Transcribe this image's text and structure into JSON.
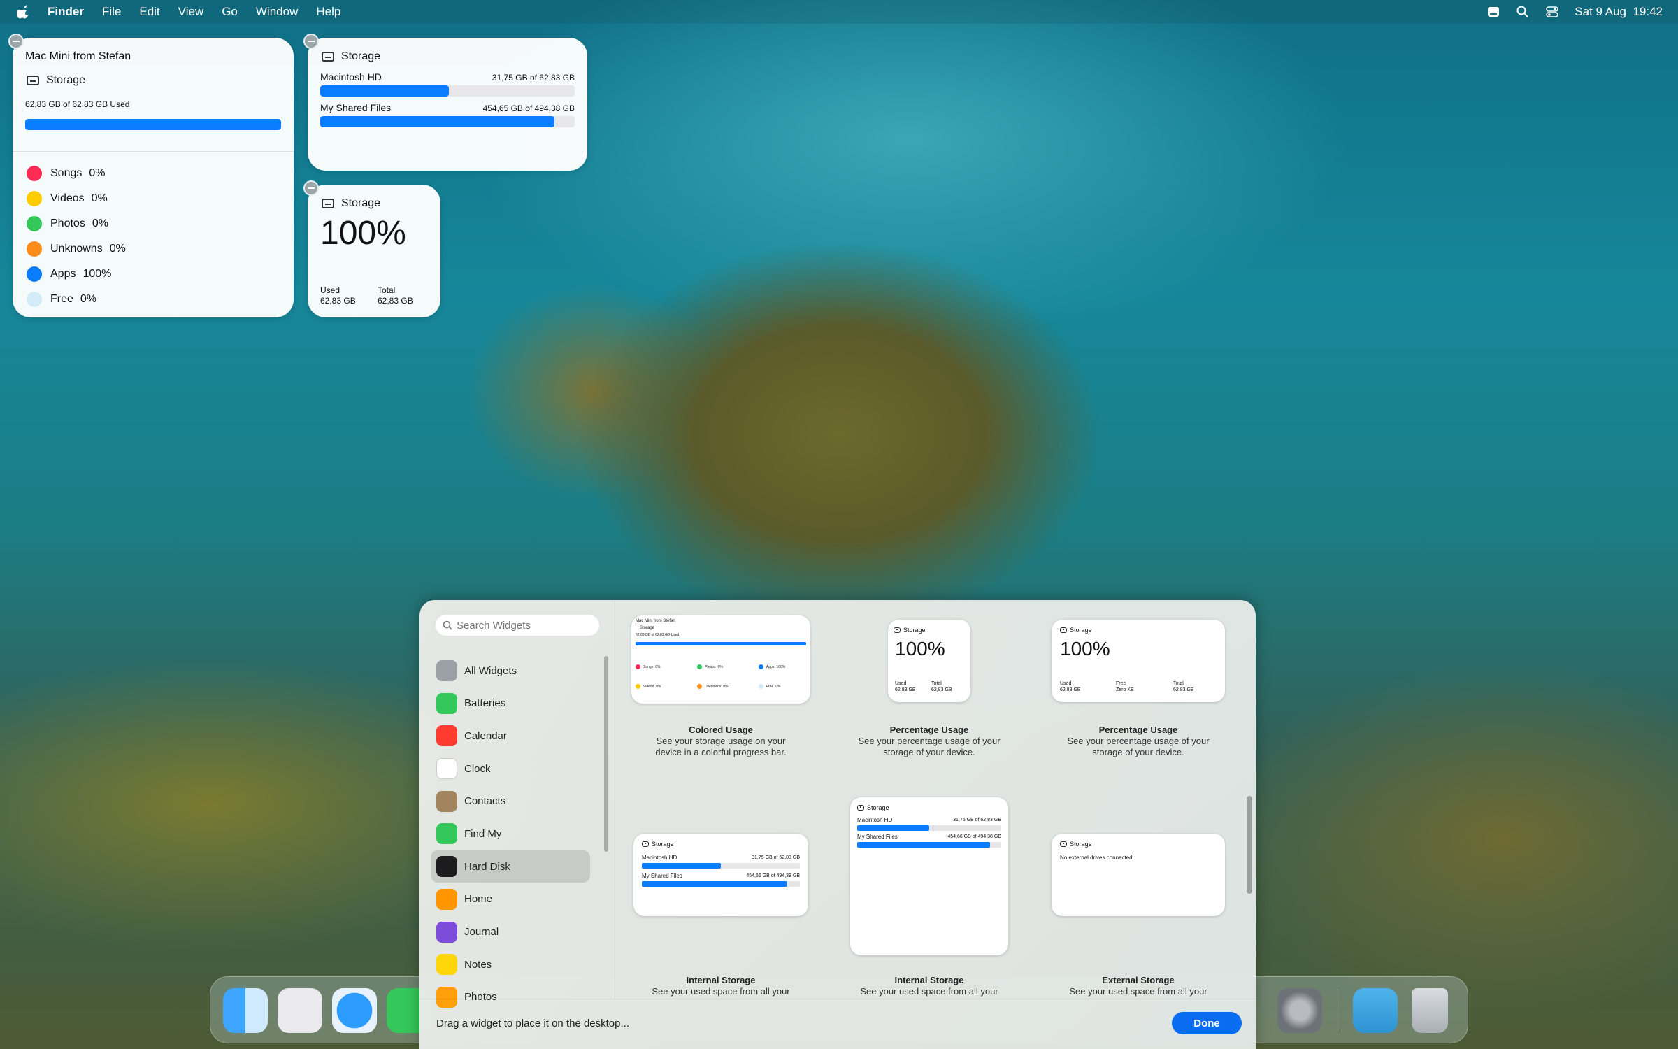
{
  "menubar": {
    "app": "Finder",
    "items": [
      "File",
      "Edit",
      "View",
      "Go",
      "Window",
      "Help"
    ],
    "datetime": "Sat 9 Aug  19:42"
  },
  "widget_large": {
    "device": "Mac Mini from Stefan",
    "title": "Storage",
    "used_text": "62,83 GB of 62,83 GB Used",
    "used_fraction": 1.0,
    "legend": [
      {
        "label": "Songs",
        "value": "0%",
        "color": "#ff2d55"
      },
      {
        "label": "Videos",
        "value": "0%",
        "color": "#ffcc00"
      },
      {
        "label": "Photos",
        "value": "0%",
        "color": "#34c759"
      },
      {
        "label": "Unknowns",
        "value": "0%",
        "color": "#ff8c1a"
      },
      {
        "label": "Apps",
        "value": "100%",
        "color": "#0a7cff"
      },
      {
        "label": "Free",
        "value": "0%",
        "color": "#d3ecf7"
      }
    ]
  },
  "widget_drives": {
    "title": "Storage",
    "drives": [
      {
        "name": "Macintosh HD",
        "size": "31,75 GB of 62,83 GB",
        "fraction": 0.505
      },
      {
        "name": "My Shared Files",
        "size": "454,65 GB of 494,38 GB",
        "fraction": 0.92
      }
    ]
  },
  "widget_percent": {
    "title": "Storage",
    "percent": "100%",
    "used_label": "Used",
    "used_value": "62,83 GB",
    "total_label": "Total",
    "total_value": "62,83 GB"
  },
  "gallery": {
    "search_placeholder": "Search Widgets",
    "sidebar": [
      {
        "label": "All Widgets",
        "icon": "all-widgets-icon",
        "color": "#9aa0a6"
      },
      {
        "label": "Batteries",
        "icon": "batteries-icon",
        "color": "#34c759"
      },
      {
        "label": "Calendar",
        "icon": "calendar-icon",
        "color": "#ff3b30"
      },
      {
        "label": "Clock",
        "icon": "clock-icon",
        "color": "#ffffff"
      },
      {
        "label": "Contacts",
        "icon": "contacts-icon",
        "color": "#a2845e"
      },
      {
        "label": "Find My",
        "icon": "find-my-icon",
        "color": "#34c759"
      },
      {
        "label": "Hard Disk",
        "icon": "hard-disk-icon",
        "color": "#1c1c1e"
      },
      {
        "label": "Home",
        "icon": "home-icon",
        "color": "#ff9500"
      },
      {
        "label": "Journal",
        "icon": "journal-icon",
        "color": "#7d4cdb"
      },
      {
        "label": "Notes",
        "icon": "notes-icon",
        "color": "#ffd60a"
      },
      {
        "label": "Photos",
        "icon": "photos-icon",
        "color": "#ff9f0a"
      }
    ],
    "active_item": "Hard Disk",
    "cards": [
      {
        "name": "Colored Usage",
        "desc1": "See your storage usage on your",
        "desc2": "device in a colorful progress bar."
      },
      {
        "name": "Percentage Usage",
        "desc1": "See your percentage usage of your",
        "desc2": "storage of your device."
      },
      {
        "name": "Percentage Usage",
        "desc1": "See your percentage usage of your",
        "desc2": "storage of your device."
      },
      {
        "name": "Internal Storage",
        "desc1": "See your used space from all your",
        "desc2": ""
      },
      {
        "name": "Internal Storage",
        "desc1": "See your used space from all your",
        "desc2": ""
      },
      {
        "name": "External Storage",
        "desc1": "See your used space from all your",
        "desc2": ""
      }
    ],
    "previews": {
      "colored": {
        "device": "Mac Mini from Stefan",
        "title": "Storage",
        "used": "62,83 GB of 62,83 GB Used",
        "legend": [
          {
            "label": "Songs",
            "value": "0%",
            "color": "#ff2d55"
          },
          {
            "label": "Photos",
            "value": "0%",
            "color": "#34c759"
          },
          {
            "label": "Apps",
            "value": "100%",
            "color": "#0a7cff"
          },
          {
            "label": "Videos",
            "value": "0%",
            "color": "#ffcc00"
          },
          {
            "label": "Unknowns",
            "value": "0%",
            "color": "#ff8c1a"
          },
          {
            "label": "Free",
            "value": "0%",
            "color": "#d3ecf7"
          }
        ]
      },
      "percent1": {
        "title": "Storage",
        "percent": "100%",
        "used_label": "Used",
        "used_value": "62,83 GB",
        "total_label": "Total",
        "total_value": "62,83 GB"
      },
      "percent2": {
        "title": "Storage",
        "percent": "100%",
        "used_label": "Used",
        "used_value": "62,83 GB",
        "free_label": "Free",
        "free_value": "Zero KB",
        "total_label": "Total",
        "total_value": "62,83 GB"
      },
      "internal1": {
        "title": "Storage",
        "d1_name": "Macintosh HD",
        "d1_size": "31,75 GB of 62,83 GB",
        "d2_name": "My Shared Files",
        "d2_size": "454,66 GB of 494,38 GB"
      },
      "internal2": {
        "title": "Storage",
        "d1_name": "Macintosh HD",
        "d1_size": "31,75 GB of 62,83 GB",
        "d2_name": "My Shared Files",
        "d2_size": "454,66 GB of 494,38 GB"
      },
      "external": {
        "title": "Storage",
        "message": "No external drives connected"
      }
    },
    "footer_hint": "Drag a widget to place it on the desktop...",
    "done_label": "Done"
  }
}
